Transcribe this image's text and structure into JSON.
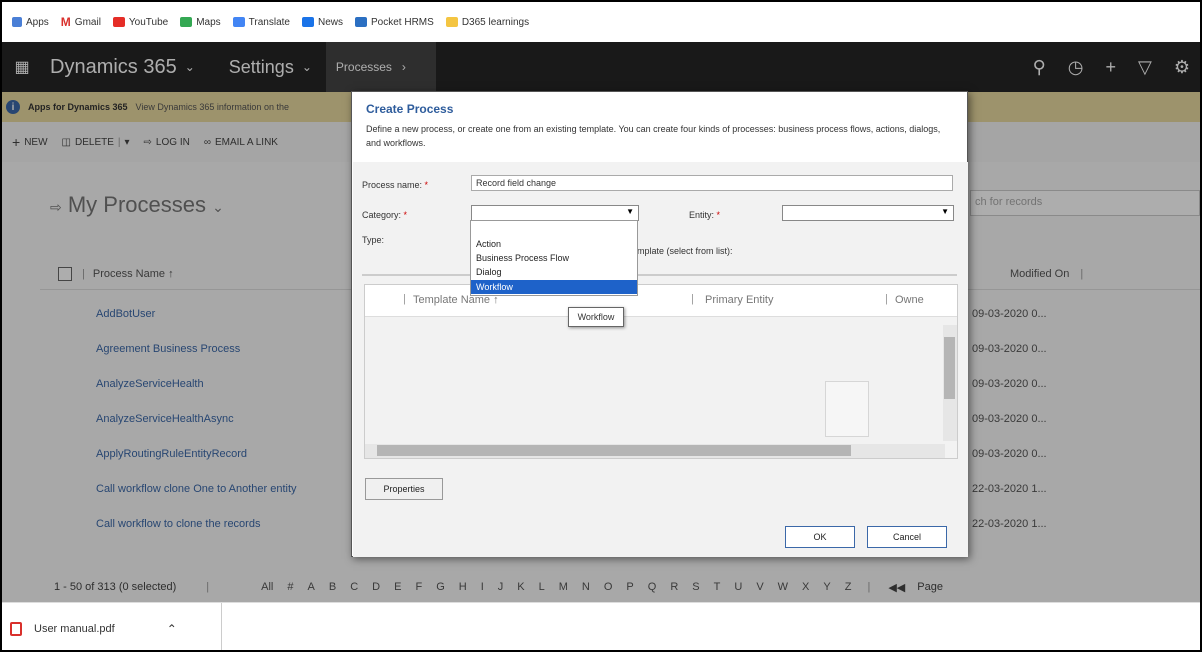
{
  "bookmarks": [
    {
      "label": "Apps",
      "icon": "apps-grid-icon",
      "color": "#4a7fd6"
    },
    {
      "label": "Gmail",
      "icon": "gmail-icon",
      "color": "#d9302c"
    },
    {
      "label": "YouTube",
      "icon": "youtube-icon",
      "color": "#e52d27"
    },
    {
      "label": "Maps",
      "icon": "maps-icon",
      "color": "#34a853"
    },
    {
      "label": "Translate",
      "icon": "translate-icon",
      "color": "#4285f4"
    },
    {
      "label": "News",
      "icon": "news-icon",
      "color": "#1a73e8"
    },
    {
      "label": "Pocket HRMS",
      "icon": "pocket-hrms-icon",
      "color": "#2b6fc2"
    },
    {
      "label": "D365 learnings",
      "icon": "folder-icon",
      "color": "#f4c542"
    }
  ],
  "nav": {
    "app_title": "Dynamics 365",
    "area": "Settings",
    "breadcrumb": "Processes"
  },
  "notification": {
    "bold": "Apps for Dynamics 365",
    "text": "View Dynamics 365 information on the"
  },
  "commands": {
    "new": "NEW",
    "delete": "DELETE",
    "log_in": "LOG IN",
    "email_link": "EMAIL A LINK"
  },
  "view": {
    "title": "My Processes",
    "search_placeholder": "ch for records",
    "col_name": "Process Name",
    "col_modified": "Modified On"
  },
  "rows": [
    {
      "name": "AddBotUser",
      "modified": "09-03-2020 0..."
    },
    {
      "name": "Agreement Business Process",
      "modified": "09-03-2020 0..."
    },
    {
      "name": "AnalyzeServiceHealth",
      "modified": "09-03-2020 0..."
    },
    {
      "name": "AnalyzeServiceHealthAsync",
      "modified": "09-03-2020 0..."
    },
    {
      "name": "ApplyRoutingRuleEntityRecord",
      "modified": "09-03-2020 0..."
    },
    {
      "name": "Call workflow clone One to Another entity",
      "modified": "22-03-2020 1..."
    },
    {
      "name": "Call workflow to clone the records",
      "modified": "22-03-2020 1..."
    }
  ],
  "pager": {
    "count": "1 - 50 of 313 (0 selected)",
    "all": "All",
    "hash": "#",
    "letters": [
      "A",
      "B",
      "C",
      "D",
      "E",
      "F",
      "G",
      "H",
      "I",
      "J",
      "K",
      "L",
      "M",
      "N",
      "O",
      "P",
      "Q",
      "R",
      "S",
      "T",
      "U",
      "V",
      "W",
      "X",
      "Y",
      "Z"
    ],
    "page": "Page"
  },
  "dialog": {
    "title": "Create Process",
    "description": "Define a new process, or create one from an existing template. You can create four kinds of processes: business process flows, actions, dialogs, and workflows.",
    "process_name_label": "Process name:",
    "process_name_value": "Record field change",
    "category_label": "Category:",
    "category_value": "",
    "entity_label": "Entity:",
    "entity_value": "",
    "type_label": "Type:",
    "template_text": "mplate (select from list):",
    "col_template": "Template Name",
    "col_entity": "Primary Entity",
    "col_owner": "Owne",
    "properties_button": "Properties",
    "ok_button": "OK",
    "cancel_button": "Cancel"
  },
  "dropdown": {
    "options": [
      "Action",
      "Business Process Flow",
      "Dialog",
      "Workflow"
    ],
    "selected": "Workflow",
    "tooltip": "Workflow"
  },
  "download": {
    "filename": "User manual.pdf"
  }
}
